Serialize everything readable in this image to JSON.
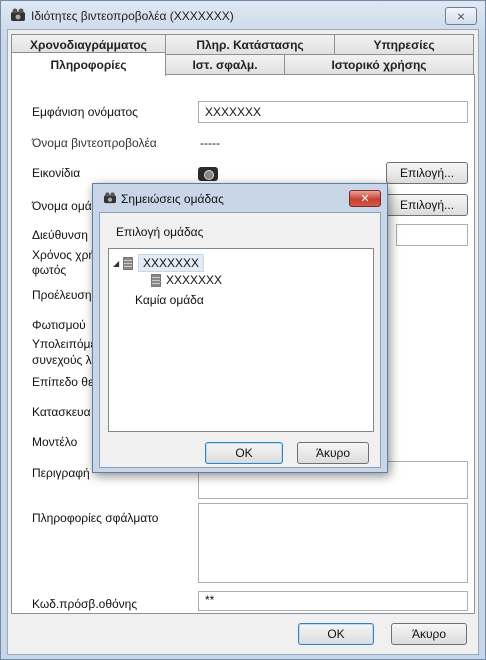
{
  "window": {
    "title": "Ιδιότητες βιντεοπροβολέα (XXXXXXX)",
    "close_icon": "close-icon",
    "close_glyph": "⨯"
  },
  "tabs": {
    "row1": [
      "Χρονοδιαγράμματος",
      "Πληρ. Κατάστασης",
      "Υπηρεσίες"
    ],
    "row2": [
      "Πληροφορίες",
      "Ιστ. σφαλμ.",
      "Ιστορικό χρήσης"
    ],
    "active": "Πληροφορίες"
  },
  "form": {
    "display_name_label": "Εμφάνιση ονόματος",
    "display_name_value": "XXXXXXX",
    "projector_name_label": "Όνομα βιντεοπροβολέα",
    "projector_name_value": "-----",
    "icons_label": "Εικονίδια",
    "icons_button": "Επιλογή...",
    "group_name_label": "Όνομα ομά",
    "group_button": "Επιλογή...",
    "address_label": "Διεύθυνση",
    "lamp_time_label_1": "Χρόνος χρή",
    "lamp_time_label_2": "φωτός",
    "source_label": "Προέλευση",
    "lighting_label": "Φωτισμού",
    "remaining_label_1": "Υπολειπόμε",
    "remaining_label_2": "συνεχούς λ",
    "level_label": "Επίπεδο θε",
    "manufacturer_label": "Κατασκευα",
    "model_label": "Μοντέλο",
    "description_label": "Περιγραφή",
    "error_info_label": "Πληροφορίες σφάλματο",
    "screen_access_label": "Κωδ.πρόσβ.οθόνης",
    "screen_access_value": "**"
  },
  "footer": {
    "ok": "OK",
    "cancel": "Άκυρο"
  },
  "dialog": {
    "title": "Σημειώσεις ομάδας",
    "close_glyph": "✕",
    "select_label": "Επιλογή ομάδας",
    "tree": {
      "root": "XXXXXXX",
      "child": "XXXXXXX",
      "none": "Καμία ομάδα",
      "expand_glyph": "◢"
    },
    "ok": "OK",
    "cancel": "Άκυρο"
  }
}
